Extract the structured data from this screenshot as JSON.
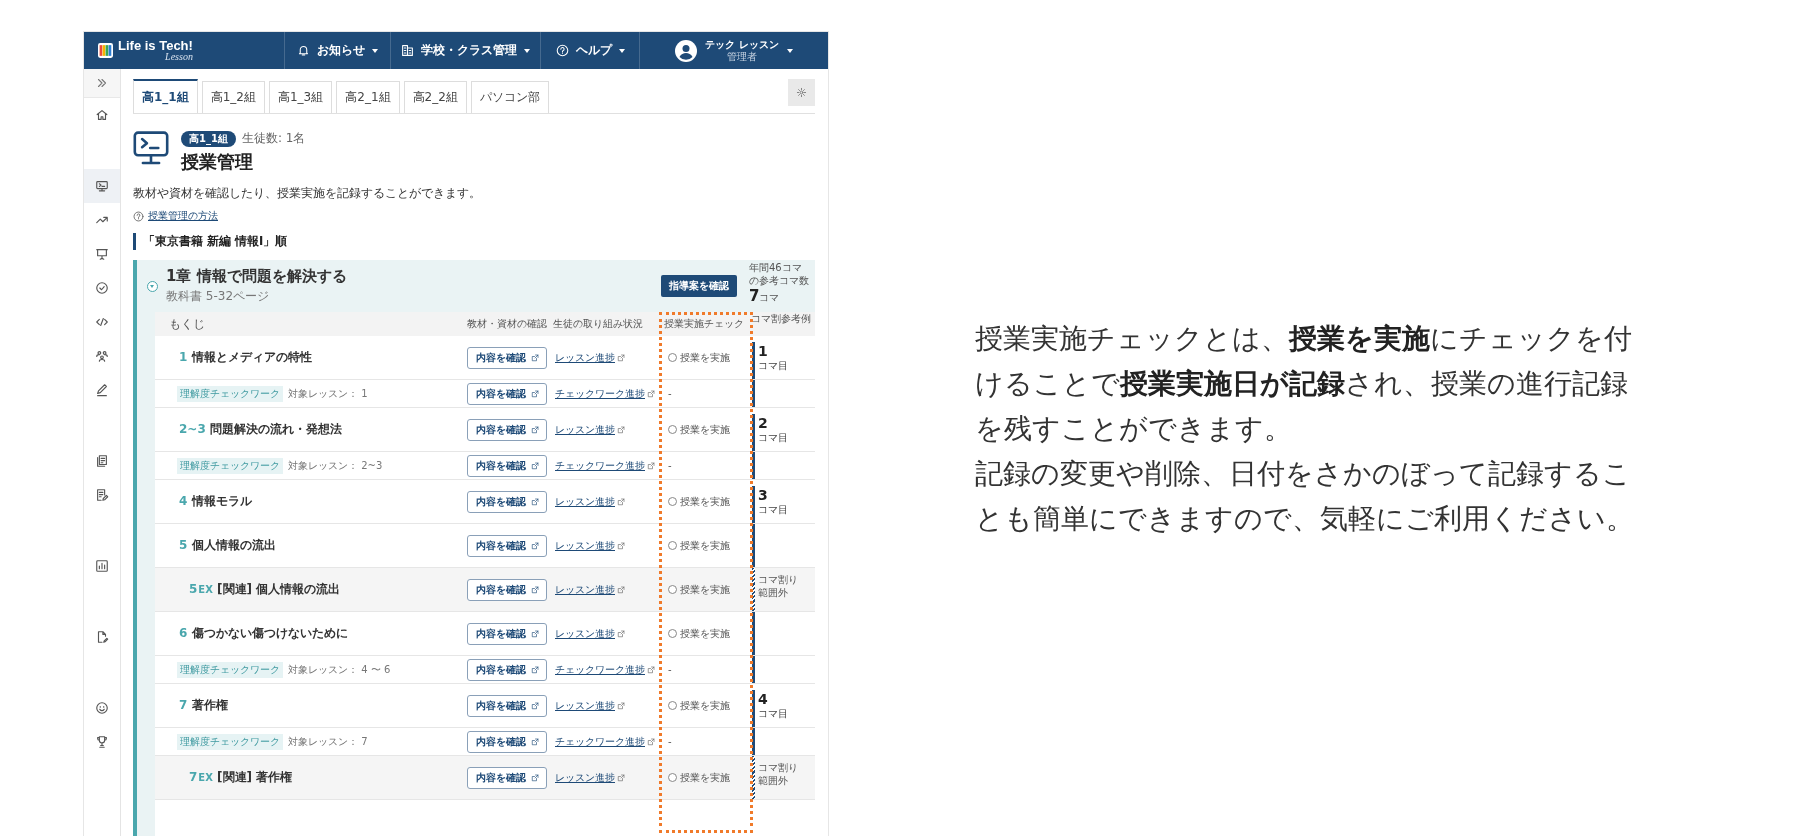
{
  "header": {
    "logo": {
      "text": "Life is Tech!",
      "subtext": "Lesson"
    },
    "nav": [
      {
        "kind": "bell",
        "label": "お知らせ"
      },
      {
        "kind": "building",
        "label": "学校・クラス管理"
      },
      {
        "kind": "help",
        "label": "ヘルプ"
      }
    ],
    "user": {
      "name": "テック レッスン",
      "role": "管理者"
    }
  },
  "sidebar": {
    "groups": [
      {
        "items": [
          {
            "kind": "home",
            "selected": false
          }
        ]
      },
      {
        "items": [
          {
            "kind": "monitor",
            "selected": true
          },
          {
            "kind": "trend",
            "selected": false
          },
          {
            "kind": "presentation",
            "selected": false
          },
          {
            "kind": "check",
            "selected": false
          },
          {
            "kind": "code",
            "selected": false
          },
          {
            "kind": "people",
            "selected": false
          },
          {
            "kind": "pencil",
            "selected": false
          }
        ]
      },
      {
        "items": [
          {
            "kind": "documents",
            "selected": false
          },
          {
            "kind": "doc-edit",
            "selected": false
          }
        ]
      },
      {
        "items": [
          {
            "kind": "chart",
            "selected": false
          }
        ]
      },
      {
        "items": [
          {
            "kind": "file-edit",
            "selected": false
          }
        ]
      },
      {
        "items": [
          {
            "kind": "smiley",
            "selected": false
          },
          {
            "kind": "trophy",
            "selected": false
          }
        ]
      }
    ]
  },
  "tabs": [
    {
      "label": "高1_1組",
      "selected": true
    },
    {
      "label": "高1_2組",
      "selected": false
    },
    {
      "label": "高1_3組",
      "selected": false
    },
    {
      "label": "高2_1組",
      "selected": false
    },
    {
      "label": "高2_2組",
      "selected": false
    },
    {
      "label": "パソコン部",
      "selected": false
    }
  ],
  "page": {
    "badge": "高1_1組",
    "student_count": "生徒数: 1名",
    "title": "授業管理",
    "description": "教材や資材を確認したり、授業実施を記録することができます。",
    "help_link": "授業管理の方法",
    "section_heading": "「東京書籍 新編 情報I」順"
  },
  "chapter": {
    "expanded": true,
    "title": "1章 情報で問題を解決する",
    "pages": "教科書 5-32ページ",
    "guide_button": "指導案を確認",
    "koma_label": "年間46コマの参考コマ数",
    "koma_count": "7",
    "koma_unit": "コマ"
  },
  "table": {
    "columns": [
      {
        "label": "もくじ",
        "highlighted": false
      },
      {
        "label": "教材・資材の確認",
        "highlighted": false
      },
      {
        "label": "生徒の取り組み状況",
        "highlighted": false
      },
      {
        "label": "授業実施チェック",
        "highlighted": true
      },
      {
        "label": "コマ割参考例",
        "highlighted": false
      }
    ],
    "rows": [
      {
        "kind": "lesson",
        "number": "1",
        "title": "情報とメディアの特性",
        "content_button": "内容を確認",
        "progress_link": "レッスン進捗",
        "check": {
          "label": "授業を実施",
          "checked": false
        },
        "out_of_range": false,
        "koma": {
          "number": "1",
          "unit": "コマ目"
        }
      },
      {
        "kind": "worksheet",
        "tag": "理解度チェックワーク",
        "target": "対象レッスン： 1",
        "content_button": "内容を確認",
        "progress_link": "チェックワーク進捗",
        "check_text": "-",
        "out_of_range": false
      },
      {
        "kind": "lesson",
        "number": "2~3",
        "title": "問題解決の流れ・発想法",
        "content_button": "内容を確認",
        "progress_link": "レッスン進捗",
        "check": {
          "label": "授業を実施",
          "checked": false
        },
        "out_of_range": false,
        "koma": {
          "number": "2",
          "unit": "コマ目"
        }
      },
      {
        "kind": "worksheet",
        "tag": "理解度チェックワーク",
        "target": "対象レッスン： 2~3",
        "content_button": "内容を確認",
        "progress_link": "チェックワーク進捗",
        "check_text": "-",
        "out_of_range": false
      },
      {
        "kind": "lesson",
        "number": "4",
        "title": "情報モラル",
        "content_button": "内容を確認",
        "progress_link": "レッスン進捗",
        "check": {
          "label": "授業を実施",
          "checked": false
        },
        "out_of_range": false,
        "koma": {
          "number": "3",
          "unit": "コマ目"
        }
      },
      {
        "kind": "lesson",
        "number": "5",
        "title": "個人情報の流出",
        "content_button": "内容を確認",
        "progress_link": "レッスン進捗",
        "check": {
          "label": "授業を実施",
          "checked": false
        },
        "out_of_range": false
      },
      {
        "kind": "extra",
        "number": "5",
        "suffix": "EX",
        "title": "[関連] 個人情報の流出",
        "content_button": "内容を確認",
        "progress_link": "レッスン進捗",
        "check": {
          "label": "授業を実施",
          "checked": false
        },
        "out_of_range": true,
        "koma_note": "コマ割り範囲外"
      },
      {
        "kind": "lesson",
        "number": "6",
        "title": "傷つかない傷つけないために",
        "content_button": "内容を確認",
        "progress_link": "レッスン進捗",
        "check": {
          "label": "授業を実施",
          "checked": false
        },
        "out_of_range": false
      },
      {
        "kind": "worksheet",
        "tag": "理解度チェックワーク",
        "target": "対象レッスン： 4 〜 6",
        "content_button": "内容を確認",
        "progress_link": "チェックワーク進捗",
        "check_text": "-",
        "out_of_range": false
      },
      {
        "kind": "lesson",
        "number": "7",
        "title": "著作権",
        "content_button": "内容を確認",
        "progress_link": "レッスン進捗",
        "check": {
          "label": "授業を実施",
          "checked": false
        },
        "out_of_range": false,
        "koma": {
          "number": "4",
          "unit": "コマ目"
        }
      },
      {
        "kind": "worksheet",
        "tag": "理解度チェックワーク",
        "target": "対象レッスン： 7",
        "content_button": "内容を確認",
        "progress_link": "チェックワーク進捗",
        "check_text": "-",
        "out_of_range": false
      },
      {
        "kind": "extra",
        "number": "7",
        "suffix": "EX",
        "title": "[関連] 著作権",
        "content_button": "内容を確認",
        "progress_link": "レッスン進捗",
        "check": {
          "label": "授業を実施",
          "checked": false
        },
        "out_of_range": true,
        "koma_note": "コマ割り範囲外"
      }
    ]
  },
  "note": {
    "paragraphs": [
      "授業実施チェックとは、**授業を実施**にチェックを付けることで**授業実施日が記録**され、授業の進行記録を残すことができます。",
      "記録の変更や削除、日付をさかのぼって記録することも簡単にできますので、気軽にご利用ください。"
    ]
  }
}
